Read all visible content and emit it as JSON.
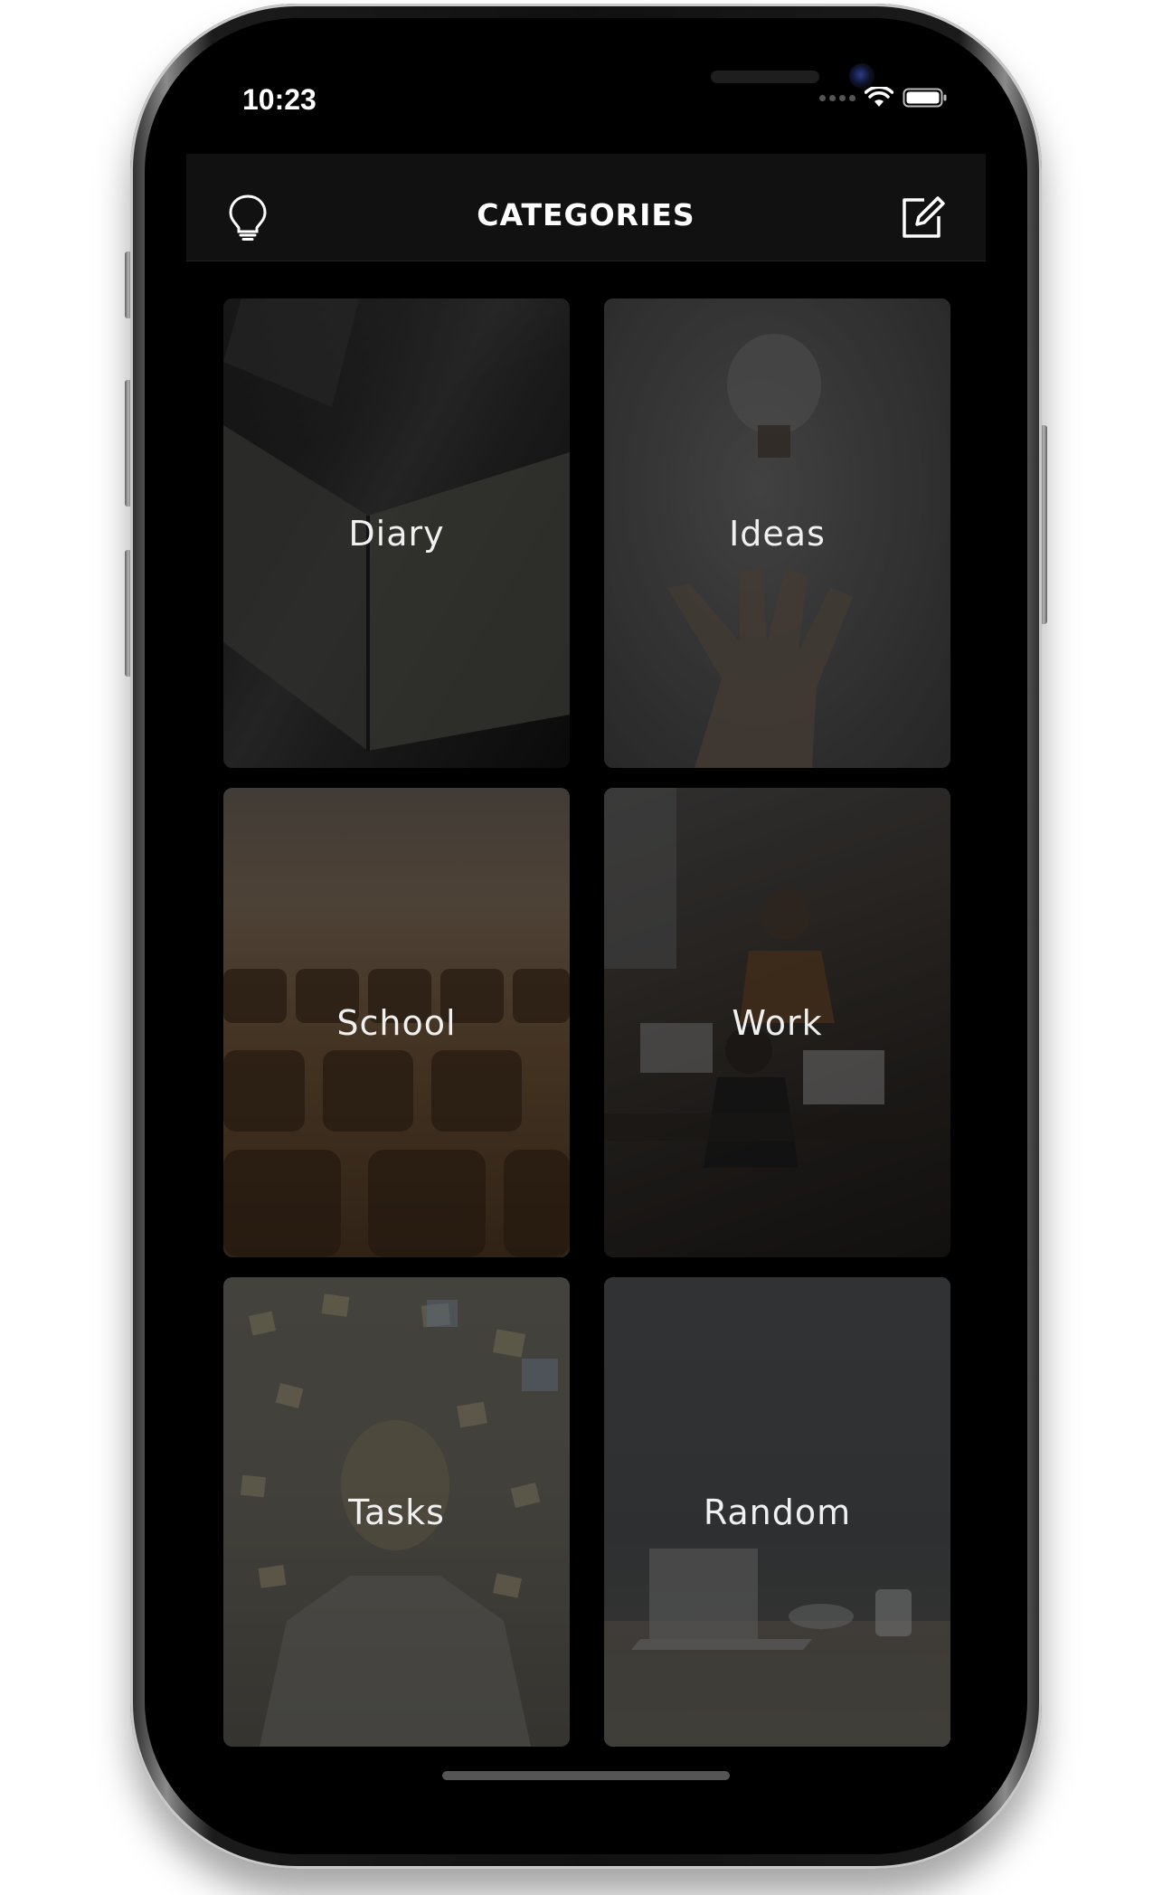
{
  "status_bar": {
    "time": "10:23"
  },
  "nav": {
    "title": "CATEGORIES",
    "left_icon": "lightbulb-icon",
    "right_icon": "compose-icon"
  },
  "categories": [
    {
      "label": "Diary"
    },
    {
      "label": "Ideas"
    },
    {
      "label": "School"
    },
    {
      "label": "Work"
    },
    {
      "label": "Tasks"
    },
    {
      "label": "Random"
    }
  ],
  "colors": {
    "screen_background": "#000000",
    "nav_background": "#111111",
    "text": "#f0f0f0"
  }
}
